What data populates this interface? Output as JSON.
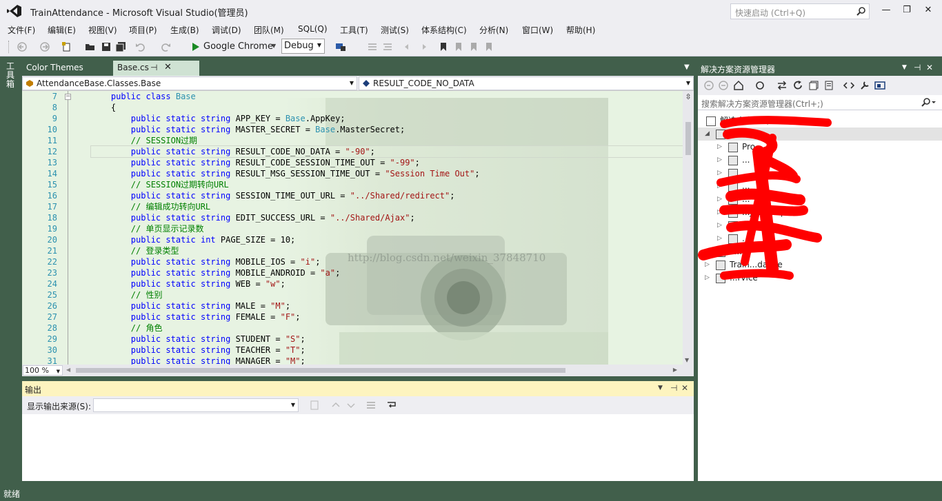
{
  "window": {
    "title": "TrainAttendance - Microsoft Visual Studio(管理员)",
    "quick_launch_placeholder": "快速启动 (Ctrl+Q)",
    "minimize": "—",
    "maximize": "❐",
    "close": "✕"
  },
  "menu": [
    "文件(F)",
    "编辑(E)",
    "视图(V)",
    "项目(P)",
    "生成(B)",
    "调试(D)",
    "团队(M)",
    "SQL(Q)",
    "工具(T)",
    "测试(S)",
    "体系结构(C)",
    "分析(N)",
    "窗口(W)",
    "帮助(H)"
  ],
  "toolbar": {
    "run_target": "Google Chrome",
    "configuration": "Debug"
  },
  "left_rail": {
    "toolbox_label": "工具箱"
  },
  "tabs": {
    "color_themes": "Color Themes",
    "base_cs": "Base.cs",
    "pin": "⊣",
    "close": "✕"
  },
  "navigation": {
    "class_path": "AttendanceBase.Classes.Base",
    "member": "RESULT_CODE_NO_DATA"
  },
  "editor": {
    "watermark": "http://blog.csdn.net/weixin_37848710",
    "zoom": "100 %",
    "lines": [
      {
        "n": "7",
        "tokens": [
          [
            "",
            "    "
          ],
          [
            "kw",
            "public"
          ],
          [
            "",
            " "
          ],
          [
            "kw",
            "class"
          ],
          [
            "",
            " "
          ],
          [
            "ty",
            "Base"
          ]
        ]
      },
      {
        "n": "8",
        "tokens": [
          [
            "",
            "    {"
          ]
        ]
      },
      {
        "n": "9",
        "tokens": [
          [
            "",
            "        "
          ],
          [
            "kw",
            "public"
          ],
          [
            "",
            " "
          ],
          [
            "kw",
            "static"
          ],
          [
            "",
            " "
          ],
          [
            "kw",
            "string"
          ],
          [
            "",
            " APP_KEY = "
          ],
          [
            "ty",
            "Base"
          ],
          [
            "",
            ".AppKey;"
          ]
        ]
      },
      {
        "n": "10",
        "tokens": [
          [
            "",
            "        "
          ],
          [
            "kw",
            "public"
          ],
          [
            "",
            " "
          ],
          [
            "kw",
            "static"
          ],
          [
            "",
            " "
          ],
          [
            "kw",
            "string"
          ],
          [
            "",
            " MASTER_SECRET = "
          ],
          [
            "ty",
            "Base"
          ],
          [
            "",
            ".MasterSecret;"
          ]
        ]
      },
      {
        "n": "11",
        "tokens": [
          [
            "",
            "        "
          ],
          [
            "cm",
            "// SESSION过期"
          ]
        ]
      },
      {
        "n": "12",
        "tokens": [
          [
            "",
            "        "
          ],
          [
            "kw",
            "public"
          ],
          [
            "",
            " "
          ],
          [
            "kw",
            "static"
          ],
          [
            "",
            " "
          ],
          [
            "kw",
            "string"
          ],
          [
            "",
            " RESULT_CODE_NO_DATA = "
          ],
          [
            "st",
            "\"-90\""
          ],
          [
            "",
            ";"
          ]
        ]
      },
      {
        "n": "13",
        "tokens": [
          [
            "",
            "        "
          ],
          [
            "kw",
            "public"
          ],
          [
            "",
            " "
          ],
          [
            "kw",
            "static"
          ],
          [
            "",
            " "
          ],
          [
            "kw",
            "string"
          ],
          [
            "",
            " RESULT_CODE_SESSION_TIME_OUT = "
          ],
          [
            "st",
            "\"-99\""
          ],
          [
            "",
            ";"
          ]
        ]
      },
      {
        "n": "14",
        "tokens": [
          [
            "",
            "        "
          ],
          [
            "kw",
            "public"
          ],
          [
            "",
            " "
          ],
          [
            "kw",
            "static"
          ],
          [
            "",
            " "
          ],
          [
            "kw",
            "string"
          ],
          [
            "",
            " RESULT_MSG_SESSION_TIME_OUT = "
          ],
          [
            "st",
            "\"Session Time Out\""
          ],
          [
            "",
            ";"
          ]
        ]
      },
      {
        "n": "15",
        "tokens": [
          [
            "",
            "        "
          ],
          [
            "cm",
            "// SESSION过期转向URL"
          ]
        ]
      },
      {
        "n": "16",
        "tokens": [
          [
            "",
            "        "
          ],
          [
            "kw",
            "public"
          ],
          [
            "",
            " "
          ],
          [
            "kw",
            "static"
          ],
          [
            "",
            " "
          ],
          [
            "kw",
            "string"
          ],
          [
            "",
            " SESSION_TIME_OUT_URL = "
          ],
          [
            "st",
            "\"../Shared/redirect\""
          ],
          [
            "",
            ";"
          ]
        ]
      },
      {
        "n": "17",
        "tokens": [
          [
            "",
            "        "
          ],
          [
            "cm",
            "// 编辑成功转向URL"
          ]
        ]
      },
      {
        "n": "18",
        "tokens": [
          [
            "",
            "        "
          ],
          [
            "kw",
            "public"
          ],
          [
            "",
            " "
          ],
          [
            "kw",
            "static"
          ],
          [
            "",
            " "
          ],
          [
            "kw",
            "string"
          ],
          [
            "",
            " EDIT_SUCCESS_URL = "
          ],
          [
            "st",
            "\"../Shared/Ajax\""
          ],
          [
            "",
            ";"
          ]
        ]
      },
      {
        "n": "19",
        "tokens": [
          [
            "",
            "        "
          ],
          [
            "cm",
            "// 单页显示记录数"
          ]
        ]
      },
      {
        "n": "20",
        "tokens": [
          [
            "",
            "        "
          ],
          [
            "kw",
            "public"
          ],
          [
            "",
            " "
          ],
          [
            "kw",
            "static"
          ],
          [
            "",
            " "
          ],
          [
            "kw",
            "int"
          ],
          [
            "",
            " PAGE_SIZE = 10;"
          ]
        ]
      },
      {
        "n": "21",
        "tokens": [
          [
            "",
            "        "
          ],
          [
            "cm",
            "// 登录类型"
          ]
        ]
      },
      {
        "n": "22",
        "tokens": [
          [
            "",
            "        "
          ],
          [
            "kw",
            "public"
          ],
          [
            "",
            " "
          ],
          [
            "kw",
            "static"
          ],
          [
            "",
            " "
          ],
          [
            "kw",
            "string"
          ],
          [
            "",
            " MOBILE_IOS = "
          ],
          [
            "st",
            "\"i\""
          ],
          [
            "",
            ";"
          ]
        ]
      },
      {
        "n": "23",
        "tokens": [
          [
            "",
            "        "
          ],
          [
            "kw",
            "public"
          ],
          [
            "",
            " "
          ],
          [
            "kw",
            "static"
          ],
          [
            "",
            " "
          ],
          [
            "kw",
            "string"
          ],
          [
            "",
            " MOBILE_ANDROID = "
          ],
          [
            "st",
            "\"a\""
          ],
          [
            "",
            ";"
          ]
        ]
      },
      {
        "n": "24",
        "tokens": [
          [
            "",
            "        "
          ],
          [
            "kw",
            "public"
          ],
          [
            "",
            " "
          ],
          [
            "kw",
            "static"
          ],
          [
            "",
            " "
          ],
          [
            "kw",
            "string"
          ],
          [
            "",
            " WEB = "
          ],
          [
            "st",
            "\"w\""
          ],
          [
            "",
            ";"
          ]
        ]
      },
      {
        "n": "25",
        "tokens": [
          [
            "",
            "        "
          ],
          [
            "cm",
            "// 性别"
          ]
        ]
      },
      {
        "n": "26",
        "tokens": [
          [
            "",
            "        "
          ],
          [
            "kw",
            "public"
          ],
          [
            "",
            " "
          ],
          [
            "kw",
            "static"
          ],
          [
            "",
            " "
          ],
          [
            "kw",
            "string"
          ],
          [
            "",
            " MALE = "
          ],
          [
            "st",
            "\"M\""
          ],
          [
            "",
            ";"
          ]
        ]
      },
      {
        "n": "27",
        "tokens": [
          [
            "",
            "        "
          ],
          [
            "kw",
            "public"
          ],
          [
            "",
            " "
          ],
          [
            "kw",
            "static"
          ],
          [
            "",
            " "
          ],
          [
            "kw",
            "string"
          ],
          [
            "",
            " FEMALE = "
          ],
          [
            "st",
            "\"F\""
          ],
          [
            "",
            ";"
          ]
        ]
      },
      {
        "n": "28",
        "tokens": [
          [
            "",
            "        "
          ],
          [
            "cm",
            "// 角色"
          ]
        ]
      },
      {
        "n": "29",
        "tokens": [
          [
            "",
            "        "
          ],
          [
            "kw",
            "public"
          ],
          [
            "",
            " "
          ],
          [
            "kw",
            "static"
          ],
          [
            "",
            " "
          ],
          [
            "kw",
            "string"
          ],
          [
            "",
            " STUDENT = "
          ],
          [
            "st",
            "\"S\""
          ],
          [
            "",
            ";"
          ]
        ]
      },
      {
        "n": "30",
        "tokens": [
          [
            "",
            "        "
          ],
          [
            "kw",
            "public"
          ],
          [
            "",
            " "
          ],
          [
            "kw",
            "static"
          ],
          [
            "",
            " "
          ],
          [
            "kw",
            "string"
          ],
          [
            "",
            " TEACHER = "
          ],
          [
            "st",
            "\"T\""
          ],
          [
            "",
            ";"
          ]
        ]
      },
      {
        "n": "31",
        "tokens": [
          [
            "",
            "        "
          ],
          [
            "kw",
            "public"
          ],
          [
            "",
            " "
          ],
          [
            "kw",
            "static"
          ],
          [
            "",
            " "
          ],
          [
            "kw",
            "string"
          ],
          [
            "",
            " MANAGER = "
          ],
          [
            "st",
            "\"M\""
          ],
          [
            "",
            ";"
          ]
        ]
      }
    ]
  },
  "output": {
    "title": "输出",
    "source_label": "显示输出来源(S):",
    "source_value": ""
  },
  "solution_explorer": {
    "title": "解决方案资源管理器",
    "search_placeholder": "搜索解决方案资源管理器(Ctrl+;)",
    "items": [
      {
        "label": "解决方案'...'(...项目)",
        "level": 0
      },
      {
        "label": "",
        "level": 0
      },
      {
        "label": "Pro...",
        "level": 2
      },
      {
        "label": "...",
        "level": 2
      },
      {
        "label": "...",
        "level": 2
      },
      {
        "label": "...",
        "level": 2
      },
      {
        "label": "...",
        "level": 2
      },
      {
        "label": "...JsonHelper.cs",
        "level": 2
      },
      {
        "label": "...",
        "level": 2
      },
      {
        "label": "...",
        "level": 2
      },
      {
        "label": "c...",
        "level": 1
      },
      {
        "label": "Train...dance",
        "level": 1
      },
      {
        "label": "...rvice",
        "level": 1
      }
    ]
  },
  "status": {
    "text": "就绪"
  },
  "colors": {
    "chrome": "#eeeef2",
    "frame": "#415f4b",
    "editor_bg": "#e7f3e2",
    "keyword": "#0000ff",
    "type": "#2b91af",
    "string": "#a31515",
    "comment": "#008000",
    "redaction": "#ff0000"
  }
}
